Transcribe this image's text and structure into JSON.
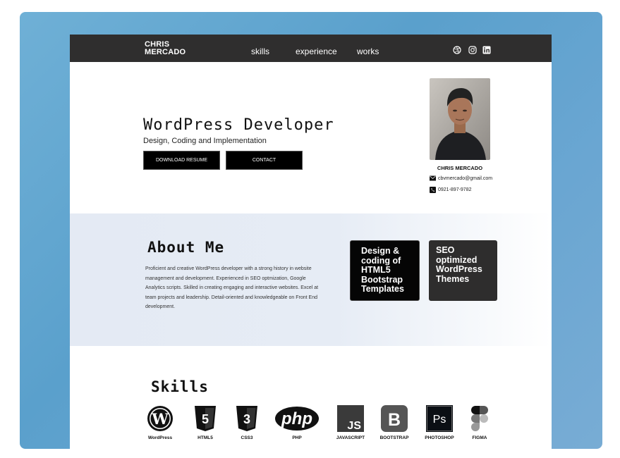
{
  "nav": {
    "logo_line1": "CHRIS",
    "logo_line2": "MERCADO",
    "links": [
      "skills",
      "experience",
      "works"
    ],
    "social_icons": [
      "dribbble-icon",
      "instagram-icon",
      "linkedin-icon"
    ]
  },
  "hero": {
    "title": "WordPress Developer",
    "subtitle": "Design, Coding and Implementation",
    "download_label": "DOWNLOAD RESUME",
    "contact_label": "CONTACT",
    "name": "CHRIS MERCADO",
    "email": "cbvmercado@gmail.com",
    "phone": "0921-897-9782"
  },
  "about": {
    "title": "About Me",
    "text": "Proficient and creative WordPress developer with a strong history in website management and development. Experienced in SEO optmization, Google Analytics scripts.  Skilled in creating engaging and interactive websites. Excel at team projects and leadership. Detail-oriented and knowledgeable on Front End development.",
    "card1": "Design & coding of HTML5 Bootstrap Templates",
    "card2": "SEO optimized WordPress Themes"
  },
  "skills": {
    "title": "Skills",
    "items": [
      "WordPress",
      "HTML5",
      "CSS3",
      "PHP",
      "JAVASCRIPT",
      "BOOTSTRAP",
      "PHOTOSHOP",
      "FIGMA"
    ]
  }
}
